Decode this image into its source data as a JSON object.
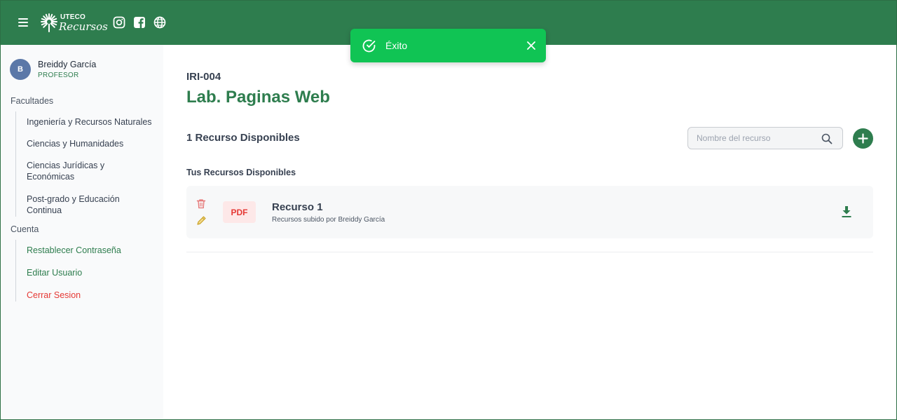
{
  "header": {
    "logo_top": "UTECO",
    "logo_bottom": "Recursos",
    "social_icons": [
      "instagram-icon",
      "facebook-icon",
      "globe-icon"
    ],
    "bg_color": "#2e7d4e"
  },
  "user": {
    "initial": "B",
    "name": "Breiddy García",
    "role": "PROFESOR"
  },
  "sidebar": {
    "facultades_label": "Facultades",
    "facultades": [
      {
        "label": "Ingeniería y Recursos Naturales"
      },
      {
        "label": "Ciencias y Humanidades"
      },
      {
        "label": "Ciencias Jurídicas y Económicas"
      },
      {
        "label": "Post-grado y Educación Continua"
      }
    ],
    "cuenta_label": "Cuenta",
    "cuenta": [
      {
        "label": "Restablecer Contraseña"
      },
      {
        "label": "Editar Usuario"
      },
      {
        "label": "Cerrar Sesion"
      }
    ]
  },
  "main": {
    "code": "IRI-004",
    "title": "Lab. Paginas Web",
    "count_text": "1 Recurso Disponibles",
    "search_placeholder": "Nombre del recurso",
    "subheading": "Tus Recursos Disponibles",
    "resources": [
      {
        "type": "PDF",
        "name": "Recurso 1",
        "subtitle": "Recursos subido por Breiddy García"
      }
    ]
  },
  "toast": {
    "text": "Éxito",
    "color": "#10c454"
  }
}
